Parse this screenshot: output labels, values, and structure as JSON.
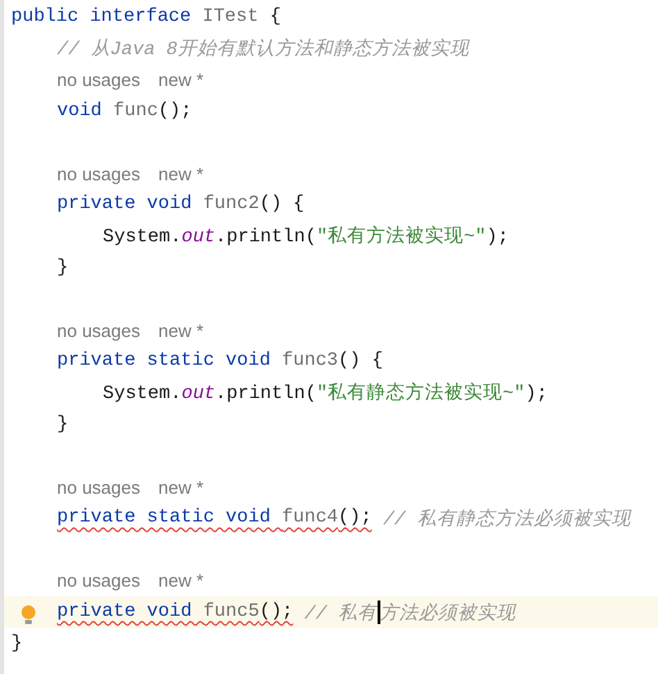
{
  "editor": {
    "lines": [
      {
        "kind": "code",
        "tokens": [
          {
            "kind": "keyword",
            "text": "public interface "
          },
          {
            "kind": "unused",
            "text": "ITest"
          },
          {
            "kind": "punct",
            "text": " {"
          }
        ],
        "children": [
          {
            "kind": "code",
            "tokens": [
              {
                "kind": "comment",
                "text": "// 从Java 8开始有默认方法和静态方法被实现"
              }
            ]
          },
          {
            "kind": "hint",
            "usages": "no usages",
            "author": "new *"
          },
          {
            "kind": "code",
            "tokens": [
              {
                "kind": "keyword",
                "text": "void "
              },
              {
                "kind": "unused",
                "text": "func"
              },
              {
                "kind": "punct",
                "text": "();"
              }
            ]
          },
          {
            "kind": "blank"
          },
          {
            "kind": "hint",
            "usages": "no usages",
            "author": "new *"
          },
          {
            "kind": "code",
            "tokens": [
              {
                "kind": "keyword",
                "text": "private void "
              },
              {
                "kind": "unused",
                "text": "func2"
              },
              {
                "kind": "punct",
                "text": "() {"
              }
            ],
            "children": [
              {
                "kind": "code",
                "tokens": [
                  {
                    "kind": "punct",
                    "text": "System."
                  },
                  {
                    "kind": "field",
                    "text": "out"
                  },
                  {
                    "kind": "punct",
                    "text": ".println("
                  },
                  {
                    "kind": "string",
                    "text": "\"私有方法被实现~\""
                  },
                  {
                    "kind": "punct",
                    "text": ");"
                  }
                ]
              }
            ]
          },
          {
            "kind": "code",
            "tokens": [
              {
                "kind": "punct",
                "text": "}"
              }
            ]
          },
          {
            "kind": "blank"
          },
          {
            "kind": "hint",
            "usages": "no usages",
            "author": "new *"
          },
          {
            "kind": "code",
            "tokens": [
              {
                "kind": "keyword",
                "text": "private static void "
              },
              {
                "kind": "unused",
                "text": "func3"
              },
              {
                "kind": "punct",
                "text": "() {"
              }
            ],
            "children": [
              {
                "kind": "code",
                "tokens": [
                  {
                    "kind": "punct",
                    "text": "System."
                  },
                  {
                    "kind": "field",
                    "text": "out"
                  },
                  {
                    "kind": "punct",
                    "text": ".println("
                  },
                  {
                    "kind": "string",
                    "text": "\"私有静态方法被实现~\""
                  },
                  {
                    "kind": "punct",
                    "text": ");"
                  }
                ]
              }
            ]
          },
          {
            "kind": "code",
            "tokens": [
              {
                "kind": "punct",
                "text": "}"
              }
            ]
          },
          {
            "kind": "blank"
          },
          {
            "kind": "hint",
            "usages": "no usages",
            "author": "new *"
          },
          {
            "kind": "code",
            "error": true,
            "tokens": [
              {
                "kind": "keyword",
                "text": "private static void "
              },
              {
                "kind": "unused",
                "text": "func4"
              },
              {
                "kind": "punct",
                "text": "();"
              }
            ],
            "trailing": [
              {
                "kind": "comment",
                "text": " // 私有静态方法必须被实现"
              }
            ]
          },
          {
            "kind": "blank"
          },
          {
            "kind": "hint",
            "usages": "no usages",
            "author": "new *"
          },
          {
            "kind": "code",
            "error": true,
            "current": true,
            "bulb": true,
            "tokens": [
              {
                "kind": "keyword",
                "text": "private void "
              },
              {
                "kind": "unused",
                "text": "func5"
              },
              {
                "kind": "punct",
                "text": "();"
              }
            ],
            "trailing": [
              {
                "kind": "comment",
                "text": " // 私有",
                "caret": true
              },
              {
                "kind": "comment",
                "text": "方法必须被实现"
              }
            ]
          }
        ]
      },
      {
        "kind": "code",
        "tokens": [
          {
            "kind": "punct",
            "text": "}"
          }
        ]
      }
    ]
  }
}
